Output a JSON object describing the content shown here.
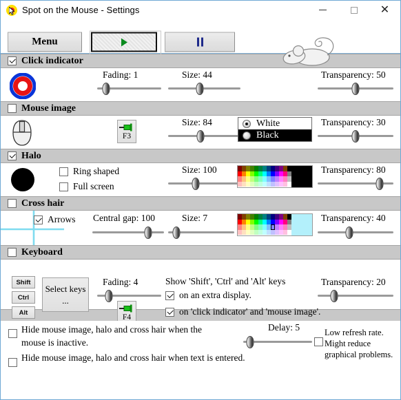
{
  "window": {
    "title": "Spot on the Mouse - Settings",
    "app_icon": "spot-on-mouse-icon",
    "minimize": "minimize-icon",
    "maximize": "maximize-icon",
    "close": "close-icon"
  },
  "toolbar": {
    "menu_label": "Menu",
    "play_icon": "play-icon",
    "pause_icon": "pause-icon",
    "decor_icon": "mouse-drawing"
  },
  "click_indicator": {
    "title": "Click indicator",
    "enabled": true,
    "preview_icon": "click-indicator-preview",
    "fading": {
      "label": "Fading:",
      "value": "1",
      "pos": 14
    },
    "size": {
      "label": "Size:",
      "value": "44",
      "pos": 44
    },
    "transparency": {
      "label": "Transparency:",
      "value": "50",
      "pos": 50
    }
  },
  "mouse_image": {
    "title": "Mouse image",
    "enabled": false,
    "preview_icon": "mouse-image-preview",
    "hotkey": {
      "label": "F3",
      "icon": "pushpin-icon"
    },
    "size": {
      "label": "Size:",
      "value": "84",
      "pos": 45
    },
    "color_options": [
      {
        "label": "White",
        "selected": true
      },
      {
        "label": "Black",
        "selected": false
      }
    ],
    "transparency": {
      "label": "Transparency:",
      "value": "30",
      "pos": 50
    }
  },
  "halo": {
    "title": "Halo",
    "enabled": true,
    "preview_icon": "halo-preview",
    "ring_shaped": {
      "label": "Ring shaped",
      "checked": false
    },
    "full_screen": {
      "label": "Full screen",
      "checked": false
    },
    "size": {
      "label": "Size:",
      "value": "100",
      "pos": 38
    },
    "color": "#000000",
    "transparency": {
      "label": "Transparency:",
      "value": "80",
      "pos": 82
    }
  },
  "cross_hair": {
    "title": "Cross hair",
    "enabled": false,
    "preview_icon": "cross-hair-preview",
    "arrows": {
      "label": "Arrows",
      "checked": true
    },
    "central_gap": {
      "label": "Central gap:",
      "value": "100",
      "pos": 78
    },
    "size": {
      "label": "Size:",
      "value": "7",
      "pos": 12
    },
    "color": "#b3f0fb",
    "transparency": {
      "label": "Transparency:",
      "value": "40",
      "pos": 42
    }
  },
  "keyboard": {
    "title": "Keyboard",
    "enabled": false,
    "keys": [
      "Shift",
      "Ctrl",
      "Alt"
    ],
    "select_keys_label": "Select keys ...",
    "fading": {
      "label": "Fading:",
      "value": "4",
      "pos": 18
    },
    "hotkey": {
      "label": "F4",
      "icon": "pushpin-icon"
    },
    "show_keys_title": "Show 'Shift', 'Ctrl' and 'Alt' keys",
    "opt_extra_display": {
      "label": "on an extra display.",
      "checked": true
    },
    "opt_click_indicator": {
      "label": "on 'click indicator' and 'mouse image'.",
      "checked": true
    },
    "transparency": {
      "label": "Transparency:",
      "value": "20",
      "pos": 22
    }
  },
  "footer": {
    "hide_inactive": {
      "line1": "Hide mouse image, halo and cross hair when the",
      "line2": "mouse is inactive.",
      "checked": false
    },
    "hide_text_entered": {
      "label": "Hide mouse image, halo and cross hair when text is entered.",
      "checked": false
    },
    "delay": {
      "label": "Delay:",
      "value": "5",
      "pos": 10
    },
    "low_refresh": {
      "line1": "Low refresh rate.",
      "line2": "Might reduce",
      "line3": "graphical problems.",
      "checked": false
    }
  },
  "palette": {
    "cols": 13,
    "rows": 4,
    "colors": [
      "#800000",
      "#804000",
      "#808000",
      "#408000",
      "#008000",
      "#008040",
      "#008080",
      "#004080",
      "#000080",
      "#400080",
      "#800080",
      "#804000",
      "#000000",
      "#ff0000",
      "#ff8000",
      "#ffff00",
      "#80ff00",
      "#00ff00",
      "#00ff80",
      "#00ffff",
      "#0080ff",
      "#0000ff",
      "#8000ff",
      "#ff00ff",
      "#ff0080",
      "#808080",
      "#ff8080",
      "#ffc080",
      "#ffff80",
      "#c0ff80",
      "#80ff80",
      "#80ffc0",
      "#80ffff",
      "#80c0ff",
      "#8080ff",
      "#c080ff",
      "#ff80ff",
      "#ff80c0",
      "#c0c0c0",
      "#ffc0c0",
      "#ffe0c0",
      "#ffffc0",
      "#e0ffc0",
      "#c0ffc0",
      "#c0ffe0",
      "#c0ffff",
      "#c0e0ff",
      "#c0c0ff",
      "#e0c0ff",
      "#ffc0ff",
      "#ffc0e0",
      "#ffffff"
    ]
  }
}
